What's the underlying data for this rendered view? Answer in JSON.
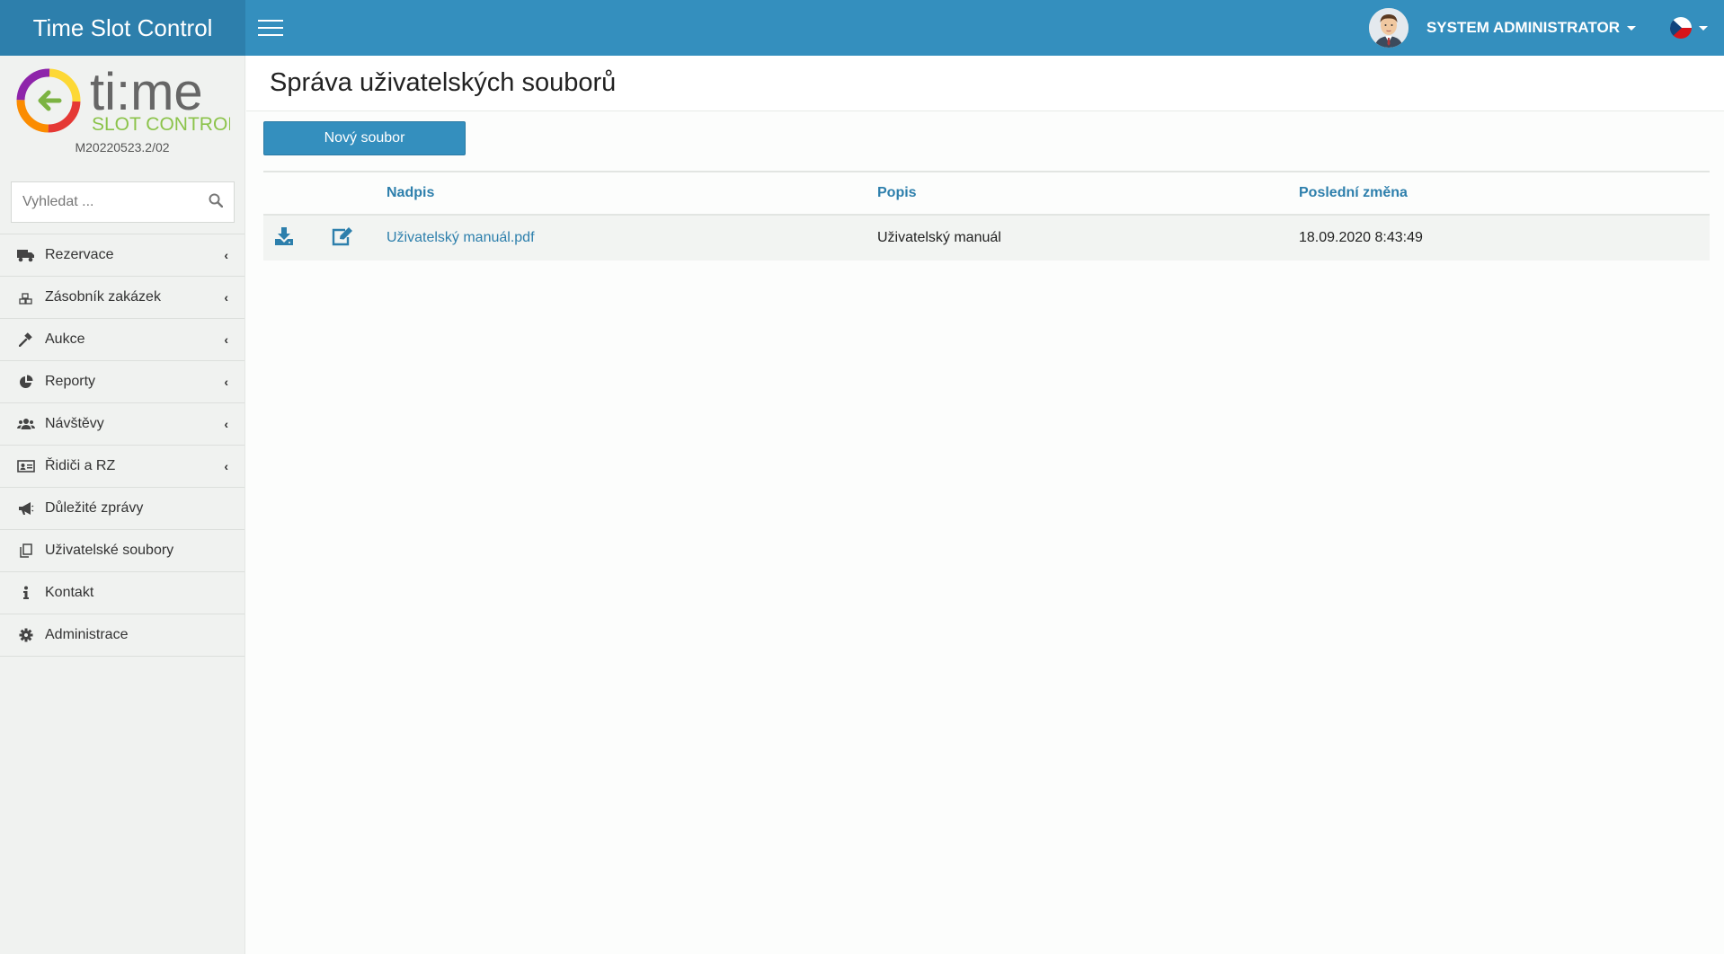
{
  "app": {
    "brand_title": "Time Slot Control"
  },
  "topbar": {
    "user_name": "SYSTEM ADMINISTRATOR",
    "language": "cz-flag-icon"
  },
  "sidebar": {
    "logo_text_main": "ti:me",
    "logo_text_sub": "SLOT CONTROL",
    "version": "M20220523.2/02",
    "search_placeholder": "Vyhledat ...",
    "items": [
      {
        "label": "Rezervace",
        "icon": "truck-icon",
        "has_submenu": true
      },
      {
        "label": "Zásobník zakázek",
        "icon": "boxes-icon",
        "has_submenu": true
      },
      {
        "label": "Aukce",
        "icon": "gavel-icon",
        "has_submenu": true
      },
      {
        "label": "Reporty",
        "icon": "pie-chart-icon",
        "has_submenu": true
      },
      {
        "label": "Návštěvy",
        "icon": "users-icon",
        "has_submenu": true
      },
      {
        "label": "Řidiči a RZ",
        "icon": "id-card-icon",
        "has_submenu": true
      },
      {
        "label": "Důležité zprávy",
        "icon": "megaphone-icon",
        "has_submenu": false
      },
      {
        "label": "Uživatelské soubory",
        "icon": "copy-icon",
        "has_submenu": false
      },
      {
        "label": "Kontakt",
        "icon": "info-icon",
        "has_submenu": false
      },
      {
        "label": "Administrace",
        "icon": "gear-icon",
        "has_submenu": false
      }
    ]
  },
  "main": {
    "page_title": "Správa uživatelských souborů",
    "new_button_label": "Nový soubor",
    "table": {
      "headers": {
        "title": "Nadpis",
        "description": "Popis",
        "last_change": "Poslední změna"
      },
      "rows": [
        {
          "title": "Uživatelský manuál.pdf",
          "description": "Uživatelský manuál",
          "last_change": "18.09.2020 8:43:49"
        }
      ]
    }
  },
  "colors": {
    "topbar": "#348fbe",
    "brand_bg": "#2d7fac",
    "accent": "#2d7fac",
    "sidebar_bg": "#f0f2f0"
  }
}
